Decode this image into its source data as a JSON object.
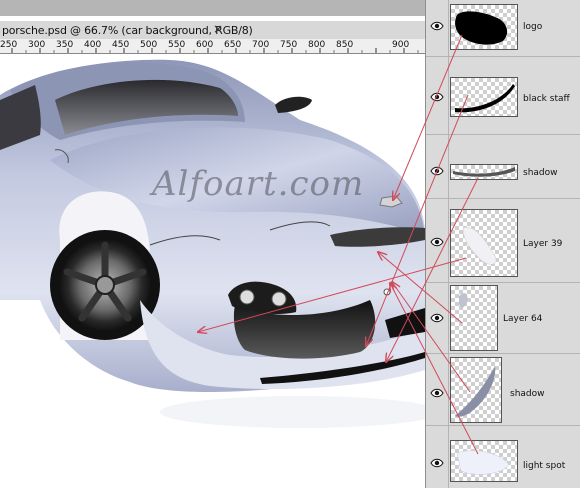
{
  "document": {
    "tab_title": "porsche.psd @ 66.7% (car background, RGB/8)",
    "close_symbol": "×",
    "ruler_ticks": [
      "250",
      "300",
      "350",
      "400",
      "450",
      "500",
      "550",
      "600",
      "650",
      "700",
      "750",
      "800",
      "850",
      "900"
    ],
    "watermark": "Alfoart.com"
  },
  "layers_panel": {
    "layers": [
      {
        "name": "logo",
        "visible": true
      },
      {
        "name": "black staff",
        "visible": true
      },
      {
        "name": "shadow",
        "visible": true
      },
      {
        "name": "Layer 39",
        "visible": true
      },
      {
        "name": "Layer 64",
        "visible": true
      },
      {
        "name": "shadow",
        "visible": true
      },
      {
        "name": "light spot",
        "visible": true
      }
    ]
  },
  "colors": {
    "arrow": "#d24a5a",
    "car_body": "#b7bdd6",
    "panel_bg": "#dcdcdc"
  }
}
